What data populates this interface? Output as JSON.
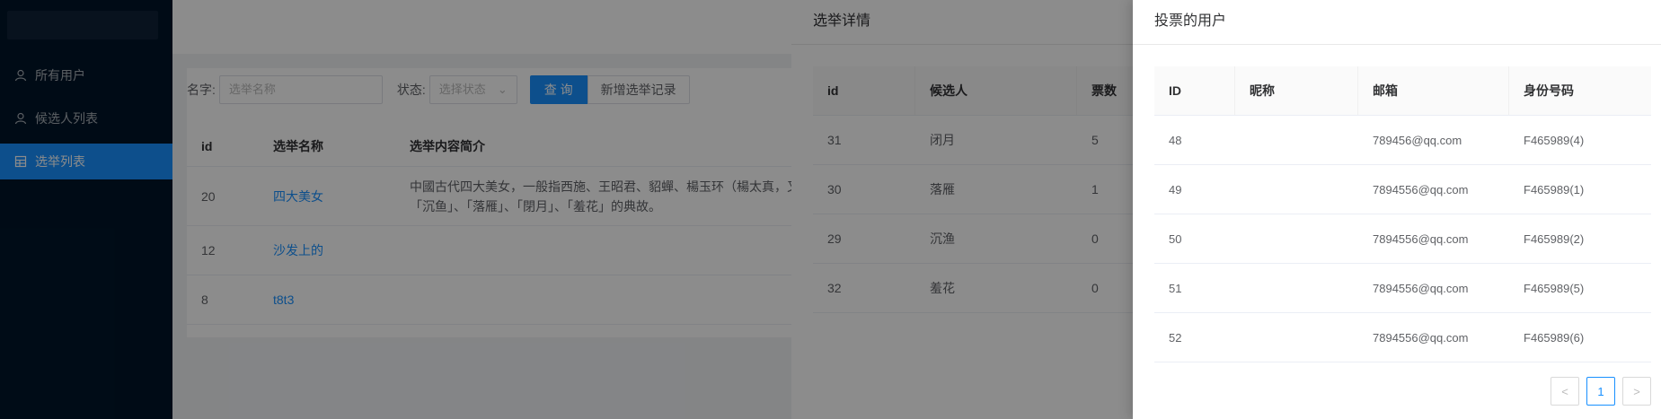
{
  "sidebar": {
    "items": [
      {
        "label": "所有用户",
        "icon": "user-icon"
      },
      {
        "label": "候选人列表",
        "icon": "user-icon"
      },
      {
        "label": "选举列表",
        "icon": "table-icon"
      }
    ]
  },
  "filter": {
    "name_label": "名字:",
    "name_placeholder": "选举名称",
    "status_label": "状态:",
    "status_placeholder": "选择状态",
    "query_button": "查 询",
    "add_button": "新增选举记录"
  },
  "election_table": {
    "headers": [
      "id",
      "选举名称",
      "选举内容简介"
    ],
    "rows": [
      {
        "id": "20",
        "name": "四大美女",
        "desc": "中國古代四大美女，一般指西施、王昭君、貂蟬、楊玉环（楊太真，又",
        "desc2": "「沉鱼」、「落雁」、「閉月」、「羞花」的典故。"
      },
      {
        "id": "12",
        "name": "沙发上的",
        "desc": "",
        "desc2": ""
      },
      {
        "id": "8",
        "name": "t8t3",
        "desc": "",
        "desc2": ""
      }
    ]
  },
  "detail_drawer": {
    "title": "选举详情",
    "headers": [
      "id",
      "候选人",
      "票数"
    ],
    "rows": [
      {
        "id": "31",
        "candidate": "闭月",
        "votes": "5"
      },
      {
        "id": "30",
        "candidate": "落雁",
        "votes": "1"
      },
      {
        "id": "29",
        "candidate": "沉渔",
        "votes": "0"
      },
      {
        "id": "32",
        "candidate": "羞花",
        "votes": "0"
      }
    ]
  },
  "voters_drawer": {
    "title": "投票的用户",
    "headers": [
      "ID",
      "昵称",
      "邮箱",
      "身份号码"
    ],
    "rows": [
      {
        "id": "48",
        "nickname": "",
        "email": "789456@qq.com",
        "idno": "F465989(4)"
      },
      {
        "id": "49",
        "nickname": "",
        "email": "7894556@qq.com",
        "idno": "F465989(1)"
      },
      {
        "id": "50",
        "nickname": "",
        "email": "7894556@qq.com",
        "idno": "F465989(2)"
      },
      {
        "id": "51",
        "nickname": "",
        "email": "7894556@qq.com",
        "idno": "F465989(5)"
      },
      {
        "id": "52",
        "nickname": "",
        "email": "7894556@qq.com",
        "idno": "F465989(6)"
      }
    ],
    "pagination": {
      "prev": "<",
      "current": "1",
      "next": ">"
    }
  },
  "colors": {
    "primary": "#1890ff",
    "sidebar_bg": "#001529"
  }
}
